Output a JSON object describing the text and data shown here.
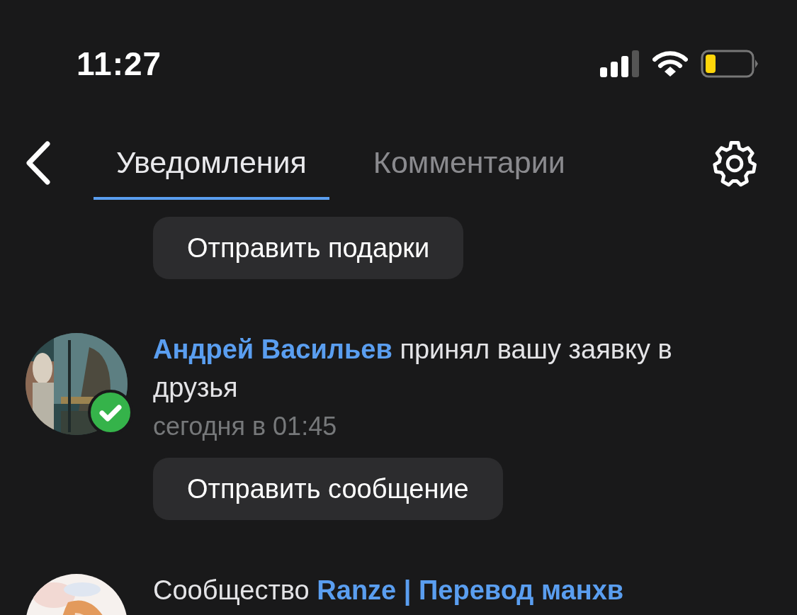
{
  "status_bar": {
    "time": "11:27"
  },
  "tabs": [
    {
      "label": "Уведомления",
      "selected": true
    },
    {
      "label": "Комментарии",
      "selected": false
    }
  ],
  "leading_button": "Отправить подарки",
  "notifications": [
    {
      "parts": [
        {
          "kind": "link",
          "text": "Андрей Васильев"
        },
        {
          "kind": "text",
          "text": "принял вашу заявку в друзья"
        }
      ],
      "time": "сегодня в 01:45",
      "check_badge": true,
      "button": "Отправить сообщение"
    },
    {
      "parts": [
        {
          "kind": "text",
          "text": "Сообщество"
        },
        {
          "kind": "link",
          "text": "Ranze | Перевод манхв"
        }
      ]
    }
  ]
}
